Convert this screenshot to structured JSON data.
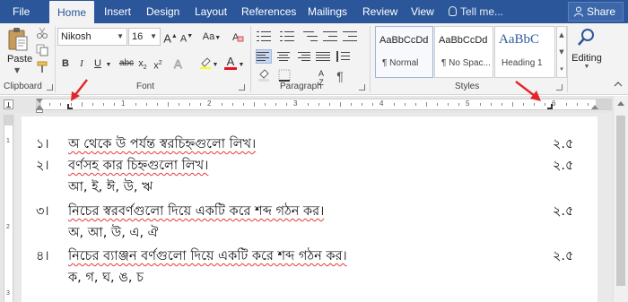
{
  "tabs": [
    {
      "label": "File",
      "active": false
    },
    {
      "label": "Home",
      "active": true
    },
    {
      "label": "Insert",
      "active": false
    },
    {
      "label": "Design",
      "active": false
    },
    {
      "label": "Layout",
      "active": false
    },
    {
      "label": "References",
      "active": false
    },
    {
      "label": "Mailings",
      "active": false
    },
    {
      "label": "Review",
      "active": false
    },
    {
      "label": "View",
      "active": false
    }
  ],
  "tell_me": "Tell me...",
  "share_label": "Share",
  "clipboard": {
    "group_label": "Clipboard",
    "paste_label": "Paste"
  },
  "font": {
    "group_label": "Font",
    "font_name": "Nikosh",
    "font_size": "16",
    "grow_label": "A",
    "shrink_label": "A",
    "case_label": "Aa",
    "bold": "B",
    "italic": "I",
    "underline": "U",
    "strike": "abc",
    "subscript": "x",
    "superscript": "x",
    "font_color_label": "A",
    "highlight_color": "#ffff00",
    "font_color": "#e81123"
  },
  "paragraph": {
    "group_label": "Paragraph",
    "pilcrow": "¶"
  },
  "styles": {
    "group_label": "Styles",
    "items": [
      {
        "sample": "AaBbCcDd",
        "name": "¶ Normal"
      },
      {
        "sample": "AaBbCcDd",
        "name": "¶ No Spac..."
      },
      {
        "sample": "AaBbC",
        "name": "Heading 1"
      }
    ]
  },
  "editing": {
    "label": "Editing"
  },
  "ruler": {
    "numbers": [
      "1",
      "2",
      "3",
      "4",
      "5",
      "6"
    ]
  },
  "vruler": {
    "numbers": [
      "1",
      "2",
      "3"
    ]
  },
  "document": {
    "questions": [
      {
        "number": "১।",
        "text": "অ থেকে উ পর্যন্ত স্বরচিহ্নগুলো লিখ।",
        "mark": "২.৫"
      },
      {
        "number": "২।",
        "text": "বর্ণসহ কার চিহ্নগুলো লিখ।",
        "sub": "আ, ই, ঈ, উ, ঋ",
        "mark": "২.৫"
      },
      {
        "number": "৩।",
        "text": "নিচের স্বরবর্ণগুলো দিয়ে একটি করে শব্দ গঠন কর।",
        "sub": "অ, আ, উ, এ, ঐ",
        "mark": "২.৫"
      },
      {
        "number": "৪।",
        "text": "নিচের ব্যাঞ্জন বর্ণগুলো দিয়ে একটি করে শব্দ গঠন কর।",
        "sub": "ক, গ, ঘ, ঙ, চ",
        "mark": "২.৫"
      }
    ]
  },
  "colors": {
    "ribbon_blue": "#2b579a",
    "annotation_red": "#e3262b"
  }
}
